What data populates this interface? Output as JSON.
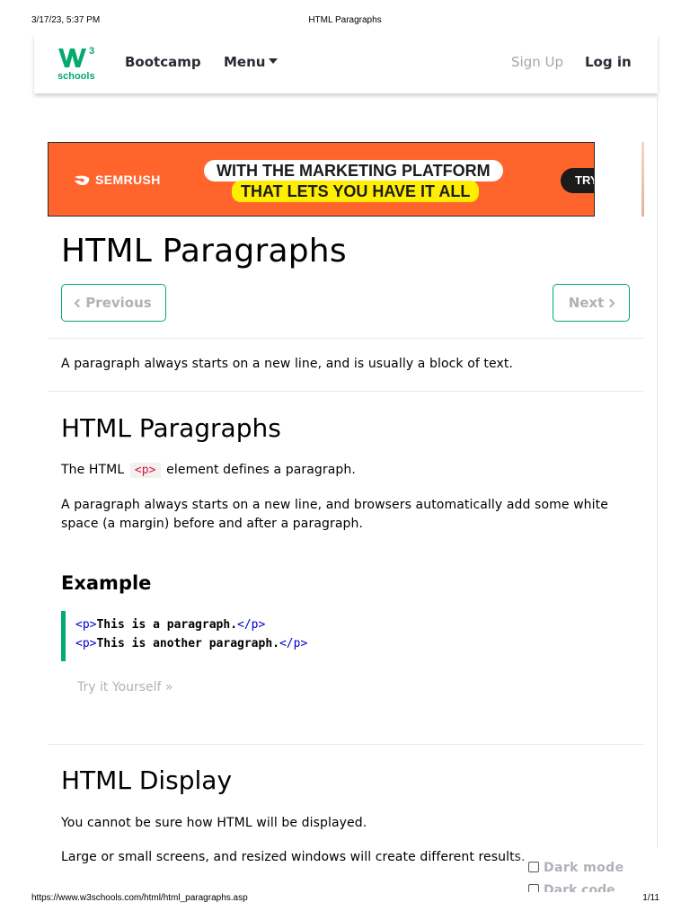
{
  "print_header": {
    "datetime": "3/17/23, 5:37 PM",
    "title": "HTML Paragraphs"
  },
  "navbar": {
    "logo_mark": "W3",
    "logo_sup": "3",
    "logo_text": "schools",
    "bootcamp": "Bootcamp",
    "menu": "Menu",
    "signup": "Sign Up",
    "login": "Log in"
  },
  "ad": {
    "brand": "SEMRUSH",
    "line1": "WITH THE MARKETING PLATFORM",
    "line2": "THAT LETS YOU HAVE IT ALL",
    "cta": "TRY"
  },
  "page": {
    "title": "HTML Paragraphs",
    "prev_label": "Previous",
    "next_label": "Next",
    "intro": "A paragraph always starts on a new line, and is usually a block of text."
  },
  "section1": {
    "heading": "HTML Paragraphs",
    "p1_before": "The HTML",
    "p1_tag": "<p>",
    "p1_after": "element defines a paragraph.",
    "p2": "A paragraph always starts on a new line, and browsers automatically add some white space (a margin) before and after a paragraph."
  },
  "example": {
    "heading": "Example",
    "lines": [
      {
        "open": "<p>",
        "text": "This is a paragraph.",
        "close": "</p>"
      },
      {
        "open": "<p>",
        "text": "This is another paragraph.",
        "close": "</p>"
      }
    ],
    "try_label": "Try it Yourself »"
  },
  "section2": {
    "heading": "HTML Display",
    "p1": "You cannot be sure how HTML will be displayed.",
    "p2": "Large or small screens, and resized windows will create different results."
  },
  "dark_mode": {
    "label": "Dark mode",
    "label2": "Dark code"
  },
  "print_footer": {
    "url": "https://www.w3schools.com/html/html_paragraphs.asp",
    "pages": "1/11"
  },
  "colors": {
    "brand_green": "#04aa6d",
    "ad_orange": "#ff642d",
    "ad_yellow": "#ffee00",
    "code_tag_blue": "#0000cd",
    "inline_tag_red": "#dc143c",
    "muted_gray": "#aeb2b8"
  }
}
